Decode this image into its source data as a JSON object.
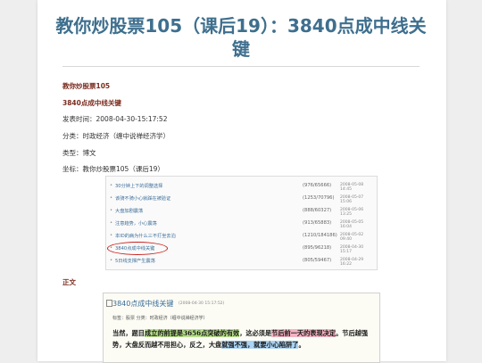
{
  "page": {
    "title": "教你炒股票105（课后19）：3840点成中线关键"
  },
  "meta": {
    "blog_name": "教你炒股票105",
    "post_title": "3840点成中线关键",
    "published": "发表时间：2008-04-30-15:17:52",
    "category": "分类：时政经济（缠中说禅经济学）",
    "type": "类型：博文",
    "label": "坐标：教你炒股票105（课后19）"
  },
  "list": {
    "rows": [
      {
        "label": "30分钟上下的调整选择",
        "count": "(976/65666)",
        "date": "2008-05-08 14:45"
      },
      {
        "label": "该骑不骑小心就踩在被验证",
        "count": "(1253/70796)",
        "date": "2008-05-07 15:06"
      },
      {
        "label": "大盘加剧震荡",
        "count": "(888/60327)",
        "date": "2008-05-06 13:25"
      },
      {
        "label": "注意趋势，小心震荡",
        "count": "(913/65883)",
        "date": "2008-05-05 16:04"
      },
      {
        "label": "本ID的病为什么三不打坐去泊",
        "count": "(1210/184186)",
        "date": "2008-05-02 09:40"
      },
      {
        "label": "3840点成中线关键",
        "count": "(895/96218)",
        "date": "2008-04-30 15:17"
      },
      {
        "label": "5日线支撑产生震荡",
        "count": "(805/59467)",
        "date": "2008-04-29 16:22"
      }
    ]
  },
  "section_label": "正文",
  "excerpt": {
    "title": "3840点成中线关键",
    "date": "(2008-04-30 15:17:52)",
    "tags": "标签：股票    分类：时政经济（缠中说禅经济学）",
    "p1_a": "当然，题目",
    "p1_green": "成立的前提是3656点突破的有效",
    "p1_b": "，这必须是",
    "p1_pink": "节后前一天的表现决定",
    "p1_c": "。节后越强势，大盘反而越不用担心，反之，大盘",
    "p1_blue": "就强不强，就要小心陷阱了",
    "p1_d": "。"
  }
}
